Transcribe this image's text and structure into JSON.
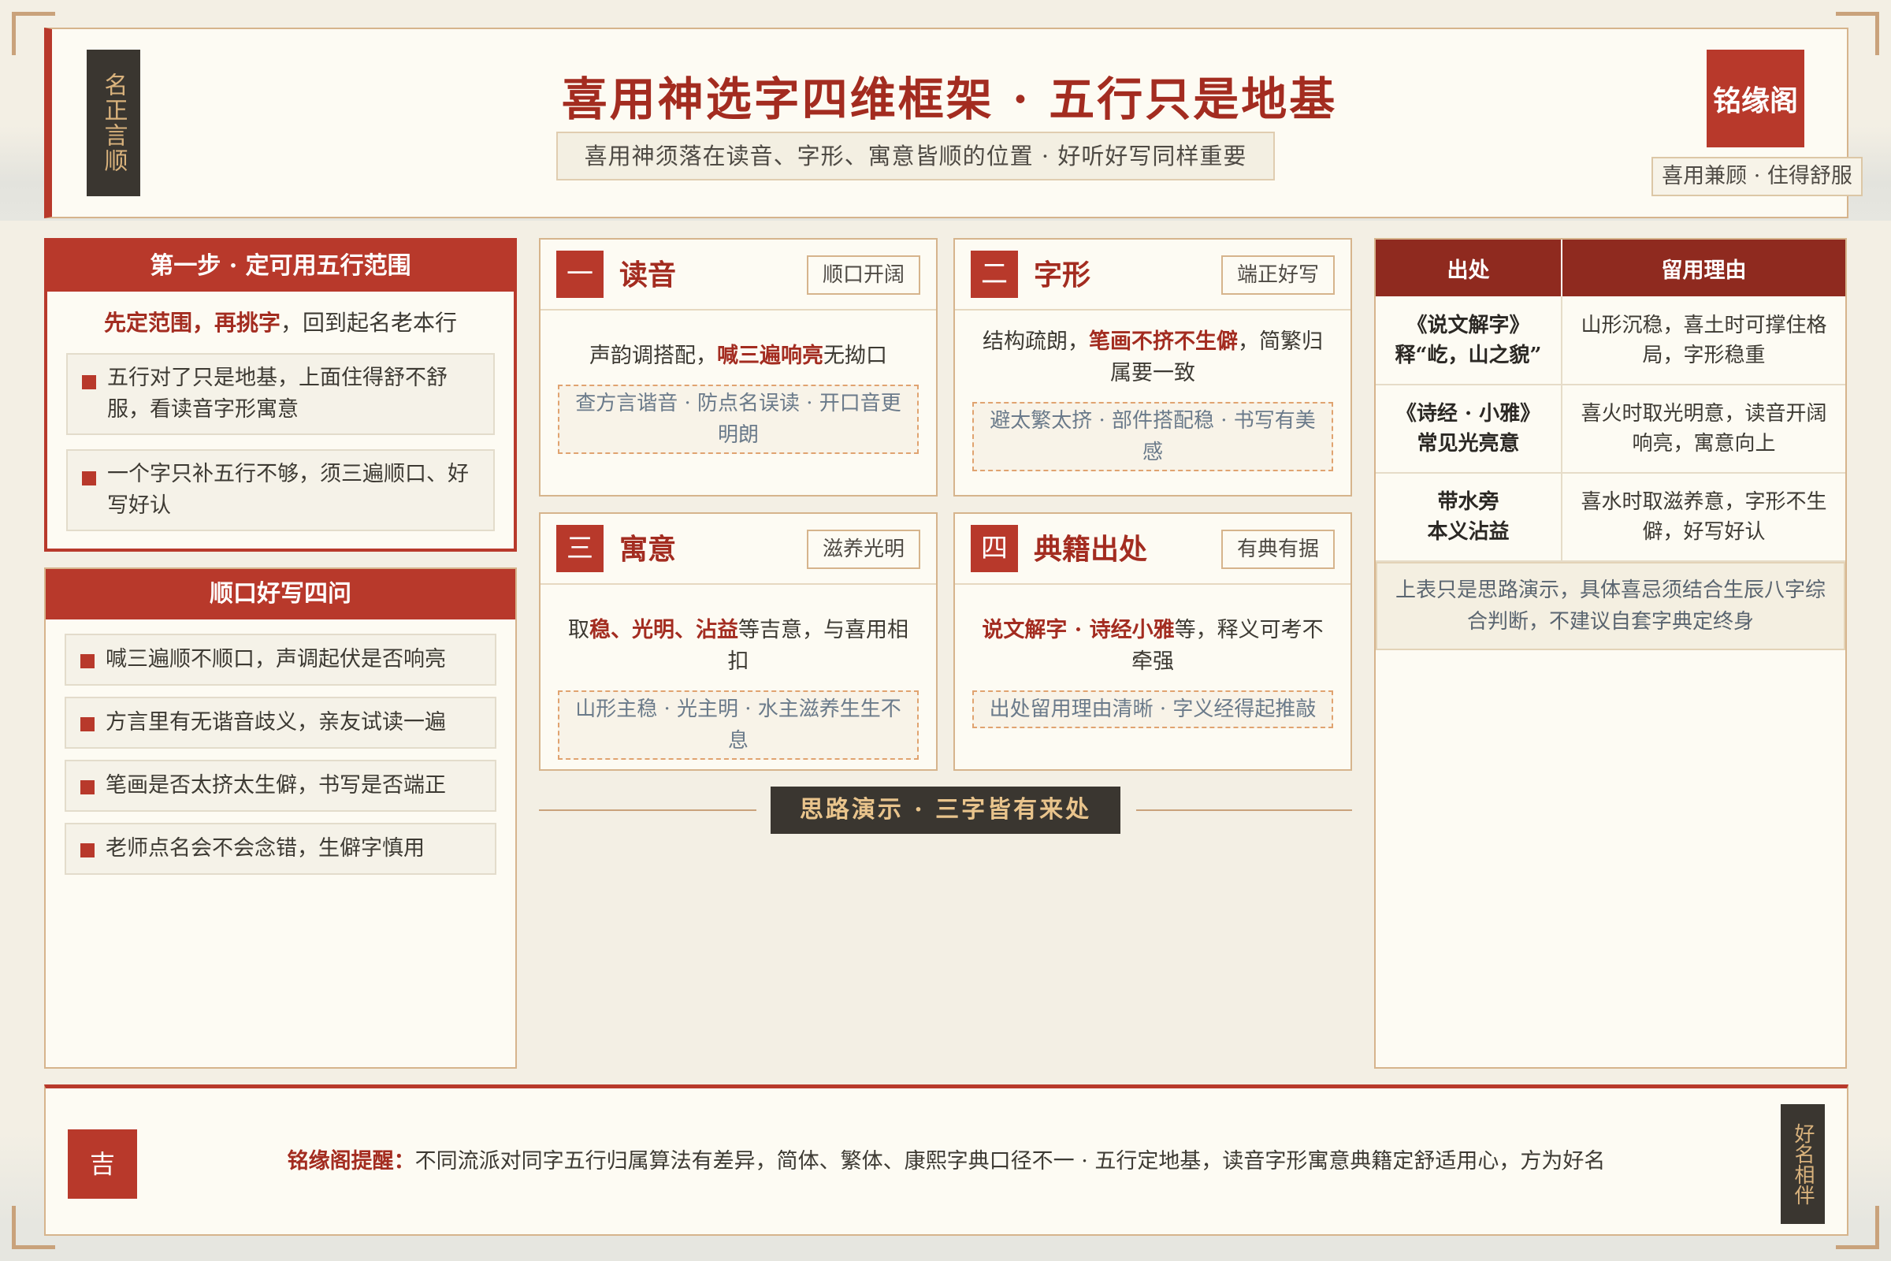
{
  "header": {
    "seal_left": "名正言顺",
    "title": "喜用神选字四维框架 · 五行只是地基",
    "subtitle": "喜用神须落在读音、字形、寓意皆顺的位置 · 好听好写同样重要",
    "brand": "铭缘阁",
    "brand_tag": "喜用兼顾 · 住得舒服"
  },
  "step_panel": {
    "title": "第一步 · 定可用五行范围",
    "lead_red": "先定范围，再挑字",
    "lead_rest": "，回到起名老本行",
    "items": [
      "五行对了只是地基，上面住得舒不舒服，看读音字形寓意",
      "一个字只补五行不够，须三遍顺口、好写好认"
    ]
  },
  "ask_panel": {
    "title": "顺口好写四问",
    "items": [
      "喊三遍顺不顺口，声调起伏是否响亮",
      "方言里有无谐音歧义，亲友试读一遍",
      "笔画是否太挤太生僻，书写是否端正",
      "老师点名会不会念错，生僻字慎用"
    ]
  },
  "cards": [
    {
      "num": "一",
      "title": "读音",
      "tag": "顺口开阔",
      "desc_pre": "声韵调搭配，",
      "desc_red": "喊三遍响亮",
      "desc_post": "无拗口",
      "note": "查方言谐音 · 防点名误读 · 开口音更明朗"
    },
    {
      "num": "二",
      "title": "字形",
      "tag": "端正好写",
      "desc_pre": "结构疏朗，",
      "desc_red": "笔画不挤不生僻",
      "desc_post": "，简繁归属要一致",
      "note": "避太繁太挤 · 部件搭配稳 · 书写有美感"
    },
    {
      "num": "三",
      "title": "寓意",
      "tag": "滋养光明",
      "desc_pre": "取",
      "desc_red": "稳、光明、沾益",
      "desc_post": "等吉意，与喜用相扣",
      "note": "山形主稳 · 光主明 · 水主滋养生生不息"
    },
    {
      "num": "四",
      "title": "典籍出处",
      "tag": "有典有据",
      "desc_pre": "",
      "desc_red": "说文解字 · 诗经小雅",
      "desc_post": "等，释义可考不牵强",
      "note": "出处留用理由清晰 · 字义经得起推敲"
    }
  ],
  "divider": {
    "label": "思路演示 · 三字皆有来处"
  },
  "table": {
    "headers": [
      "出处",
      "留用理由"
    ],
    "rows": [
      {
        "src_line1": "《说文解字》",
        "src_line2": "释“屹，山之貌”",
        "reason": "山形沉稳，喜土时可撑住格局，字形稳重"
      },
      {
        "src_line1": "《诗经 · 小雅》",
        "src_line2": "常见光亮意",
        "reason": "喜火时取光明意，读音开阔响亮，寓意向上"
      },
      {
        "src_line1": "带水旁",
        "src_line2": "本义沾益",
        "reason": "喜水时取滋养意，字形不生僻，好写好认"
      }
    ],
    "note": "上表只是思路演示，具体喜忌须结合生辰八字综合判断，不建议自套字典定终身"
  },
  "footer": {
    "ji": "吉",
    "label": "铭缘阁提醒：",
    "text": "不同流派对同字五行归属算法有差异，简体、繁体、康熙字典口径不一 · 五行定地基，读音字形寓意典籍定舒适用心，方为好名",
    "seal_right": "好名相伴"
  },
  "colors": {
    "accent_red": "#b8392b",
    "dark_red": "#8f2a1f",
    "gold": "#d6b48c",
    "ink": "#3a3630"
  }
}
